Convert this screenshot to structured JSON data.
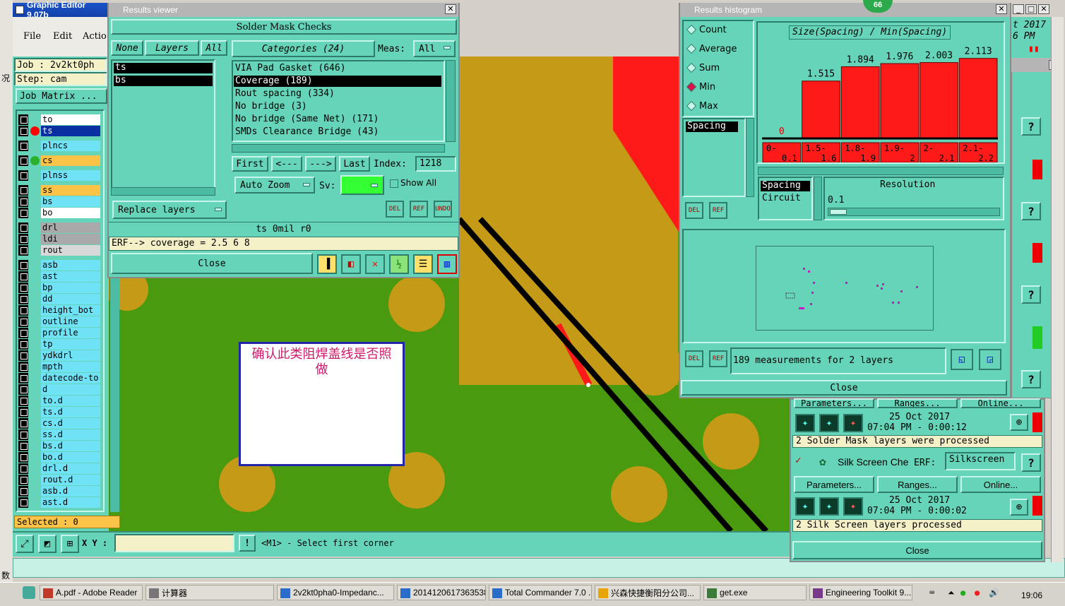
{
  "editor": {
    "title": "Graphic Editor 9.07b",
    "menu": [
      "File",
      "Edit",
      "Actio"
    ],
    "job": "Job : 2v2kt0ph",
    "step": "Step: cam",
    "job_matrix": "Job Matrix ...",
    "layers": [
      "to",
      "ts",
      "plncs",
      "cs",
      "plnss",
      "ss",
      "bs",
      "bo",
      "drl",
      "ldi",
      "rout",
      "asb",
      "ast",
      "bp",
      "dd",
      "height_bot",
      "outline",
      "profile",
      "tp",
      "ydkdrl",
      "mpth",
      "datecode-to",
      "d",
      "to.d",
      "ts.d",
      "cs.d",
      "ss.d",
      "bs.d",
      "bo.d",
      "drl.d",
      "rout.d",
      "asb.d",
      "ast.d"
    ],
    "selected": "Selected : 0",
    "xy_label": "X Y :",
    "status_hint": "<M1> - Select first corner"
  },
  "results_viewer": {
    "title": "Results viewer",
    "header": "Solder Mask Checks",
    "none": "None",
    "layers_label": "Layers",
    "all": "All",
    "layer_list": [
      "ts",
      "bs"
    ],
    "categories_label": "Categories (24)",
    "meas_label": "Meas:",
    "meas_value": "All",
    "categories": [
      "VIA Pad Gasket (646)",
      "Coverage (189)",
      "Rout spacing (334)",
      "No bridge (3)",
      "No bridge (Same Net) (171)",
      "SMDs Clearance Bridge (43)"
    ],
    "first": "First",
    "prev": "<---",
    "next": "--->",
    "last": "Last",
    "index_label": "Index:",
    "index_value": "1218",
    "auto_zoom": "Auto Zoom",
    "sv_label": "Sv:",
    "show_all": "Show All",
    "replace_layers": "Replace layers",
    "del": "DEL",
    "ref": "REF",
    "undo": "UNDO",
    "info_line": "ts 0mil   r0",
    "erf_line": "ERF--> coverage = 2.5 6 8",
    "close": "Close"
  },
  "histogram": {
    "title": "Results histogram",
    "badge": "66",
    "modes": [
      "Count",
      "Average",
      "Sum",
      "Min",
      "Max"
    ],
    "selected_mode": "Min",
    "chart_title": "Size(Spacing) / Min(Spacing)",
    "param_list": [
      "Spacing"
    ],
    "param_list2": [
      "Spacing",
      "Circuit"
    ],
    "resolution_label": "Resolution",
    "resolution_value": "0.1",
    "measurements": "189 measurements for 2 layers",
    "close": "Close",
    "del": "DEL",
    "ref": "REF"
  },
  "chart_data": {
    "type": "bar",
    "title": "Size(Spacing) / Min(Spacing)",
    "categories": [
      "0-0.1",
      "1.5-1.6",
      "1.8-1.9",
      "1.9-2",
      "2-2.1",
      "2.1-2.2"
    ],
    "values": [
      0,
      1.515,
      1.894,
      1.976,
      2.003,
      2.113
    ],
    "value_labels": [
      "0",
      "1.515",
      "1.894",
      "1.976",
      "2.003",
      "2.113"
    ],
    "ylim": [
      0,
      2.2
    ],
    "bar_color": "#ff1a1a"
  },
  "right_panel": {
    "parameters": "Parameters...",
    "ranges": "Ranges...",
    "online": "Online...",
    "date1": "25 Oct 2017",
    "time1": "07:04 PM - 0:00:12",
    "msg1": "2 Solder Mask layers were processed",
    "silk_title": "Silk Screen Che",
    "erf_label": "ERF:",
    "erf_value": "Silkscreen",
    "date2": "25 Oct 2017",
    "time2": "07:04 PM - 0:00:02",
    "msg2": "2 Silk Screen layers processed",
    "close": "Close",
    "top_date": "t 2017",
    "top_time": "6 PM"
  },
  "annotation": {
    "text": "确认此类阻焊盖线是否照做"
  },
  "taskbar": {
    "items": [
      "A.pdf - Adobe Reader",
      "计算器",
      "2v2kt0pha0-Impedanc...",
      "20141206173635384....",
      "Total Commander 7.0 ...",
      "兴森快捷衡阳分公司...",
      "get.exe",
      "Engineering Toolkit 9...."
    ],
    "clock": "19:06"
  },
  "left_edge": {
    "c1": "况",
    "c2": "数"
  }
}
